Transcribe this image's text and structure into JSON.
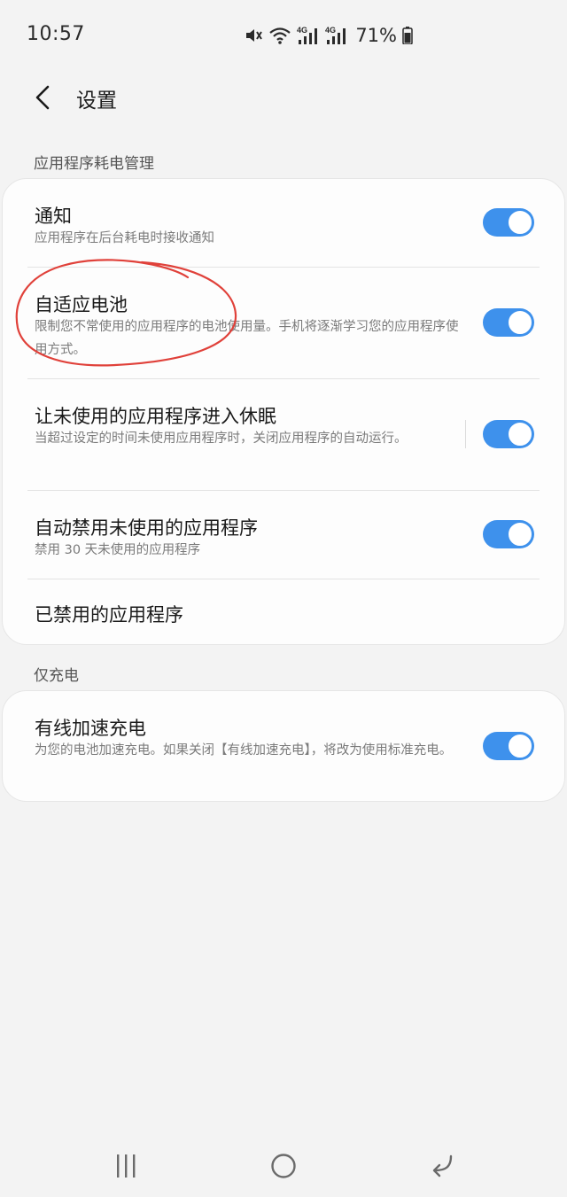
{
  "status_bar": {
    "time": "10:57",
    "battery_percent": "71%",
    "icons": [
      "mute-icon",
      "wifi-icon",
      "4g-signal-icon",
      "4g-signal-icon",
      "battery-icon"
    ],
    "network_labels": [
      "4G",
      "4G"
    ]
  },
  "header": {
    "title": "设置",
    "back_icon": "chevron-left-icon"
  },
  "sections": [
    {
      "header": "应用程序耗电管理",
      "items": [
        {
          "title": "通知",
          "desc": "应用程序在后台耗电时接收通知",
          "toggle": true
        },
        {
          "title": "自适应电池",
          "desc": "限制您不常使用的应用程序的电池使用量。手机将逐渐学习您的应用程序使用方式。",
          "toggle": true
        },
        {
          "title": "让未使用的应用程序进入休眠",
          "desc": "当超过设定的时间未使用应用程序时，关闭应用程序的自动运行。",
          "toggle": true
        },
        {
          "title": "自动禁用未使用的应用程序",
          "desc": "禁用 30 天未使用的应用程序",
          "toggle": true
        },
        {
          "title": "已禁用的应用程序"
        }
      ]
    },
    {
      "header": "仅充电",
      "items": [
        {
          "title": "有线加速充电",
          "desc": "为您的电池加速充电。如果关闭【有线加速充电】，将改为使用标准充电。",
          "toggle": true
        }
      ]
    }
  ],
  "nav_bar": {
    "icons": [
      "recent-apps-icon",
      "home-icon",
      "back-icon"
    ]
  },
  "colors": {
    "accent": "#3e91ec",
    "background": "#f3f3f3",
    "card": "#fdfdfd",
    "annotation": "#e0413a"
  }
}
